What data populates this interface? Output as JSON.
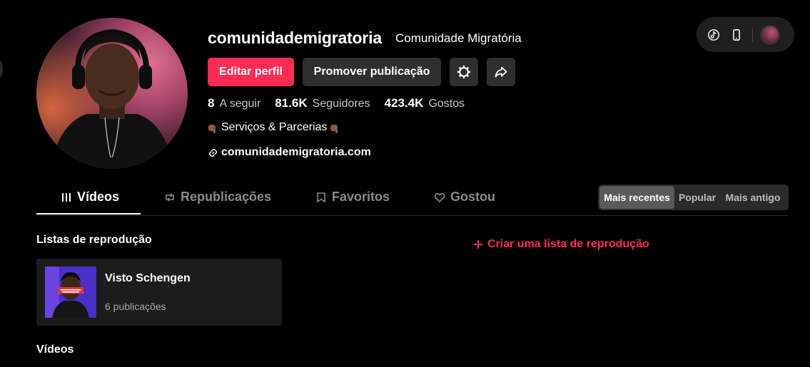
{
  "profile": {
    "username": "comunidademigratoria",
    "display_name": "Comunidade Migratória",
    "bio": "Serviços & Parcerias",
    "link": "comunidademigratoria.com"
  },
  "actions": {
    "edit_label": "Editar perfil",
    "promote_label": "Promover publicação",
    "settings_icon": "gear-icon",
    "share_icon": "share-icon"
  },
  "stats": [
    {
      "value": "8",
      "label": "A seguir"
    },
    {
      "value": "81.6K",
      "label": "Seguidores"
    },
    {
      "value": "423.4K",
      "label": "Gostos"
    }
  ],
  "tabs": [
    {
      "label": "Vídeos",
      "icon": "grid-icon",
      "active": true
    },
    {
      "label": "Republicações",
      "icon": "repost-icon",
      "active": false
    },
    {
      "label": "Favoritos",
      "icon": "bookmark-icon",
      "active": false
    },
    {
      "label": "Gostou",
      "icon": "heart-icon",
      "active": false
    }
  ],
  "sort": {
    "options": [
      "Mais recentes",
      "Popular",
      "Mais antigo"
    ],
    "selected": "Mais recentes"
  },
  "playlists": {
    "title": "Listas de reprodução",
    "create_label": "Criar uma lista de reprodução",
    "items": [
      {
        "name": "Visto Schengen",
        "count": "6 publicações"
      }
    ]
  },
  "videos": {
    "title": "Vídeos"
  },
  "colors": {
    "accent": "#fe2c55",
    "background": "#000000",
    "surface": "#2f2f2f"
  }
}
